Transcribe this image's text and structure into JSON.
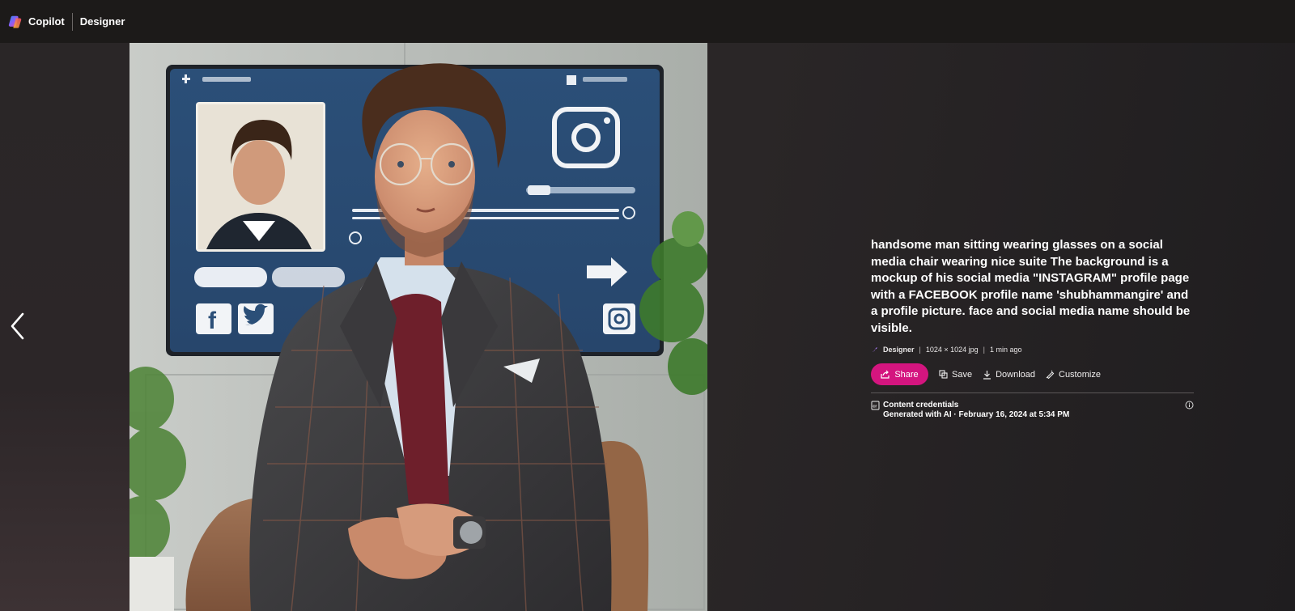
{
  "header": {
    "brand": "Copilot",
    "section": "Designer"
  },
  "image": {
    "alt": "handsome man sitting wearing glasses on a social media chair wearing nice suite The background is a mockup of his social media \"INSTAGRAM\" profile page with a FACEBOOK profile name 'shubhammangire' and a profile picture. face and social media name should be visible."
  },
  "details": {
    "prompt": "handsome man sitting wearing glasses on a social media chair wearing nice suite The background is a mockup of his social media \"INSTAGRAM\" profile page with a FACEBOOK profile name 'shubhammangire' and a profile picture. face and social media name should be visible.",
    "meta": {
      "source": "Designer",
      "dimensions": "1024 × 1024 jpg",
      "time": "1 min ago"
    },
    "actions": {
      "share": "Share",
      "save": "Save",
      "download": "Download",
      "customize": "Customize"
    },
    "credentials": {
      "title": "Content credentials",
      "subtitle": "Generated with AI · February 16, 2024 at 5:34 PM"
    }
  },
  "colors": {
    "accent": "#d4157f",
    "topbar": "#1c1a19",
    "background": "#2a2627"
  },
  "icons": [
    "copilot-logo-icon",
    "chevron-left-icon",
    "designer-icon",
    "share-icon",
    "save-icon",
    "download-icon",
    "customize-icon",
    "content-credentials-icon",
    "info-icon"
  ]
}
